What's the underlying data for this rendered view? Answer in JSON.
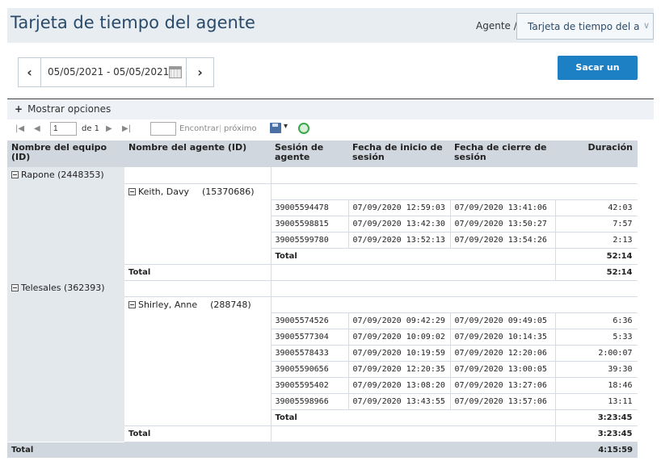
{
  "header": {
    "title": "Tarjeta de tiempo del agente",
    "agent_crumb": "Agente /",
    "agent_select_value": "Tarjeta de tiempo del agente"
  },
  "date_nav": {
    "range": "05/05/2021 - 05/05/2021"
  },
  "report_button": "Sacar un reporte",
  "options": {
    "plus": "+",
    "label": "Mostrar opciones"
  },
  "toolbar": {
    "first": "|◀",
    "prev": "◀",
    "page_value": "1",
    "of_pages": "de 1",
    "next": "▶",
    "last": "▶|",
    "find": "Encontrar",
    "sep": "|",
    "next_find": "próximo",
    "export_arrow": "▾"
  },
  "table": {
    "headers": [
      "Nombre del equipo (ID)",
      "Nombre del agente (ID)",
      "Sesión de agente",
      "Fecha de inicio de sesión",
      "Fecha de cierre de sesión",
      "Duración"
    ],
    "teams": [
      {
        "name": "Rapone (2448353)",
        "agent_name": "Keith, Davy",
        "agent_id": "(15370686)",
        "rows": [
          [
            "39005594478",
            "07/09/2020 12:59:03",
            "07/09/2020 13:41:06",
            "42:03"
          ],
          [
            "39005598815",
            "07/09/2020 13:42:30",
            "07/09/2020 13:50:27",
            "7:57"
          ],
          [
            "39005599780",
            "07/09/2020 13:52:13",
            "07/09/2020 13:54:26",
            "2:13"
          ]
        ],
        "agent_total_label": "Total",
        "agent_total": "52:14",
        "team_total_label": "Total",
        "team_total": "52:14"
      },
      {
        "name": "Telesales (362393)",
        "agent_name": "Shirley, Anne",
        "agent_id": "(288748)",
        "rows": [
          [
            "39005574526",
            "07/09/2020 09:42:29",
            "07/09/2020 09:49:05",
            "6:36"
          ],
          [
            "39005577304",
            "07/09/2020 10:09:02",
            "07/09/2020 10:14:35",
            "5:33"
          ],
          [
            "39005578433",
            "07/09/2020 10:19:59",
            "07/09/2020 12:20:06",
            "2:00:07"
          ],
          [
            "39005590656",
            "07/09/2020 12:20:35",
            "07/09/2020 13:00:05",
            "39:30"
          ],
          [
            "39005595402",
            "07/09/2020 13:08:20",
            "07/09/2020 13:27:06",
            "18:46"
          ],
          [
            "39005598966",
            "07/09/2020 13:43:55",
            "07/09/2020 13:57:06",
            "13:11"
          ]
        ],
        "agent_total_label": "Total",
        "agent_total": "3:23:45",
        "team_total_label": "Total",
        "team_total": "3:23:45"
      }
    ],
    "grand_total_label": "Total",
    "grand_total": "4:15:59"
  },
  "colors": {
    "accent": "#1d7fc4",
    "title": "#2a4a6a",
    "header_bg": "#e8edf2",
    "table_header_bg": "#d0d7de",
    "refresh_icon": "#3aa84a"
  },
  "icons": [
    "chevron-left-icon",
    "chevron-right-icon",
    "calendar-icon",
    "chevron-down-icon",
    "collapse-minus-icon",
    "export-save-icon",
    "refresh-icon"
  ]
}
